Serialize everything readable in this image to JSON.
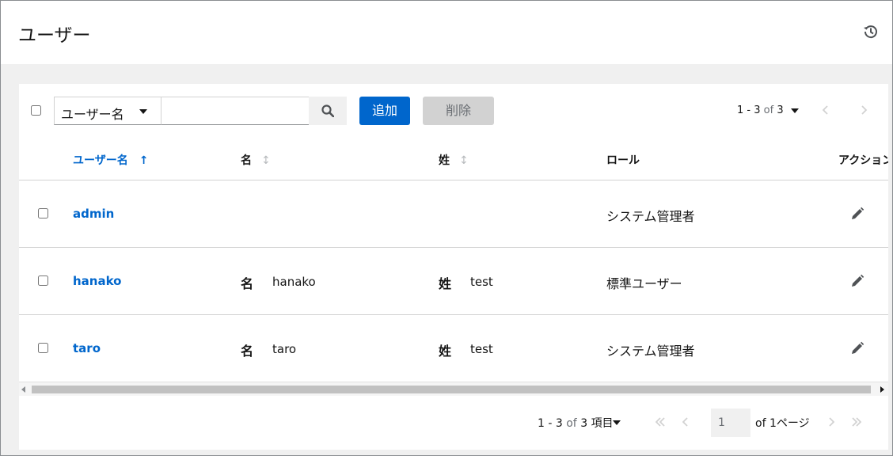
{
  "header": {
    "title": "ユーザー",
    "history_icon": "history-icon"
  },
  "toolbar": {
    "filter_select_value": "ユーザー名",
    "search_placeholder": "",
    "search_icon": "search-icon",
    "add_label": "追加",
    "delete_label": "削除",
    "pagination": {
      "range": "1 - 3",
      "of_text": "of",
      "total": "3"
    }
  },
  "table": {
    "columns": [
      {
        "label": "ユーザー名",
        "sort": "ascending"
      },
      {
        "label": "名",
        "sort": "sortable"
      },
      {
        "label": "姓",
        "sort": "sortable"
      },
      {
        "label": "ロール",
        "sort": "none"
      },
      {
        "label": "アクション",
        "sort": "none"
      }
    ],
    "rows": [
      {
        "username": "admin",
        "first_label": "",
        "first_name": "",
        "last_label": "",
        "last_name": "",
        "role": "システム管理者",
        "action_icon": "pencil-icon"
      },
      {
        "username": "hanako",
        "first_label": "名",
        "first_name": "hanako",
        "last_label": "姓",
        "last_name": "test",
        "role": "標準ユーザー",
        "action_icon": "pencil-icon"
      },
      {
        "username": "taro",
        "first_label": "名",
        "first_name": "taro",
        "last_label": "姓",
        "last_name": "test",
        "role": "システム管理者",
        "action_icon": "pencil-icon"
      }
    ]
  },
  "footer": {
    "range": "1 - 3",
    "of_text": "of",
    "total": "3",
    "items_suffix": "項目",
    "page_value": "1",
    "of_pages": "of 1ページ"
  },
  "colors": {
    "primary": "#0066cc",
    "disabled": "#d2d2d2",
    "page_bg": "#f0f0f0"
  }
}
